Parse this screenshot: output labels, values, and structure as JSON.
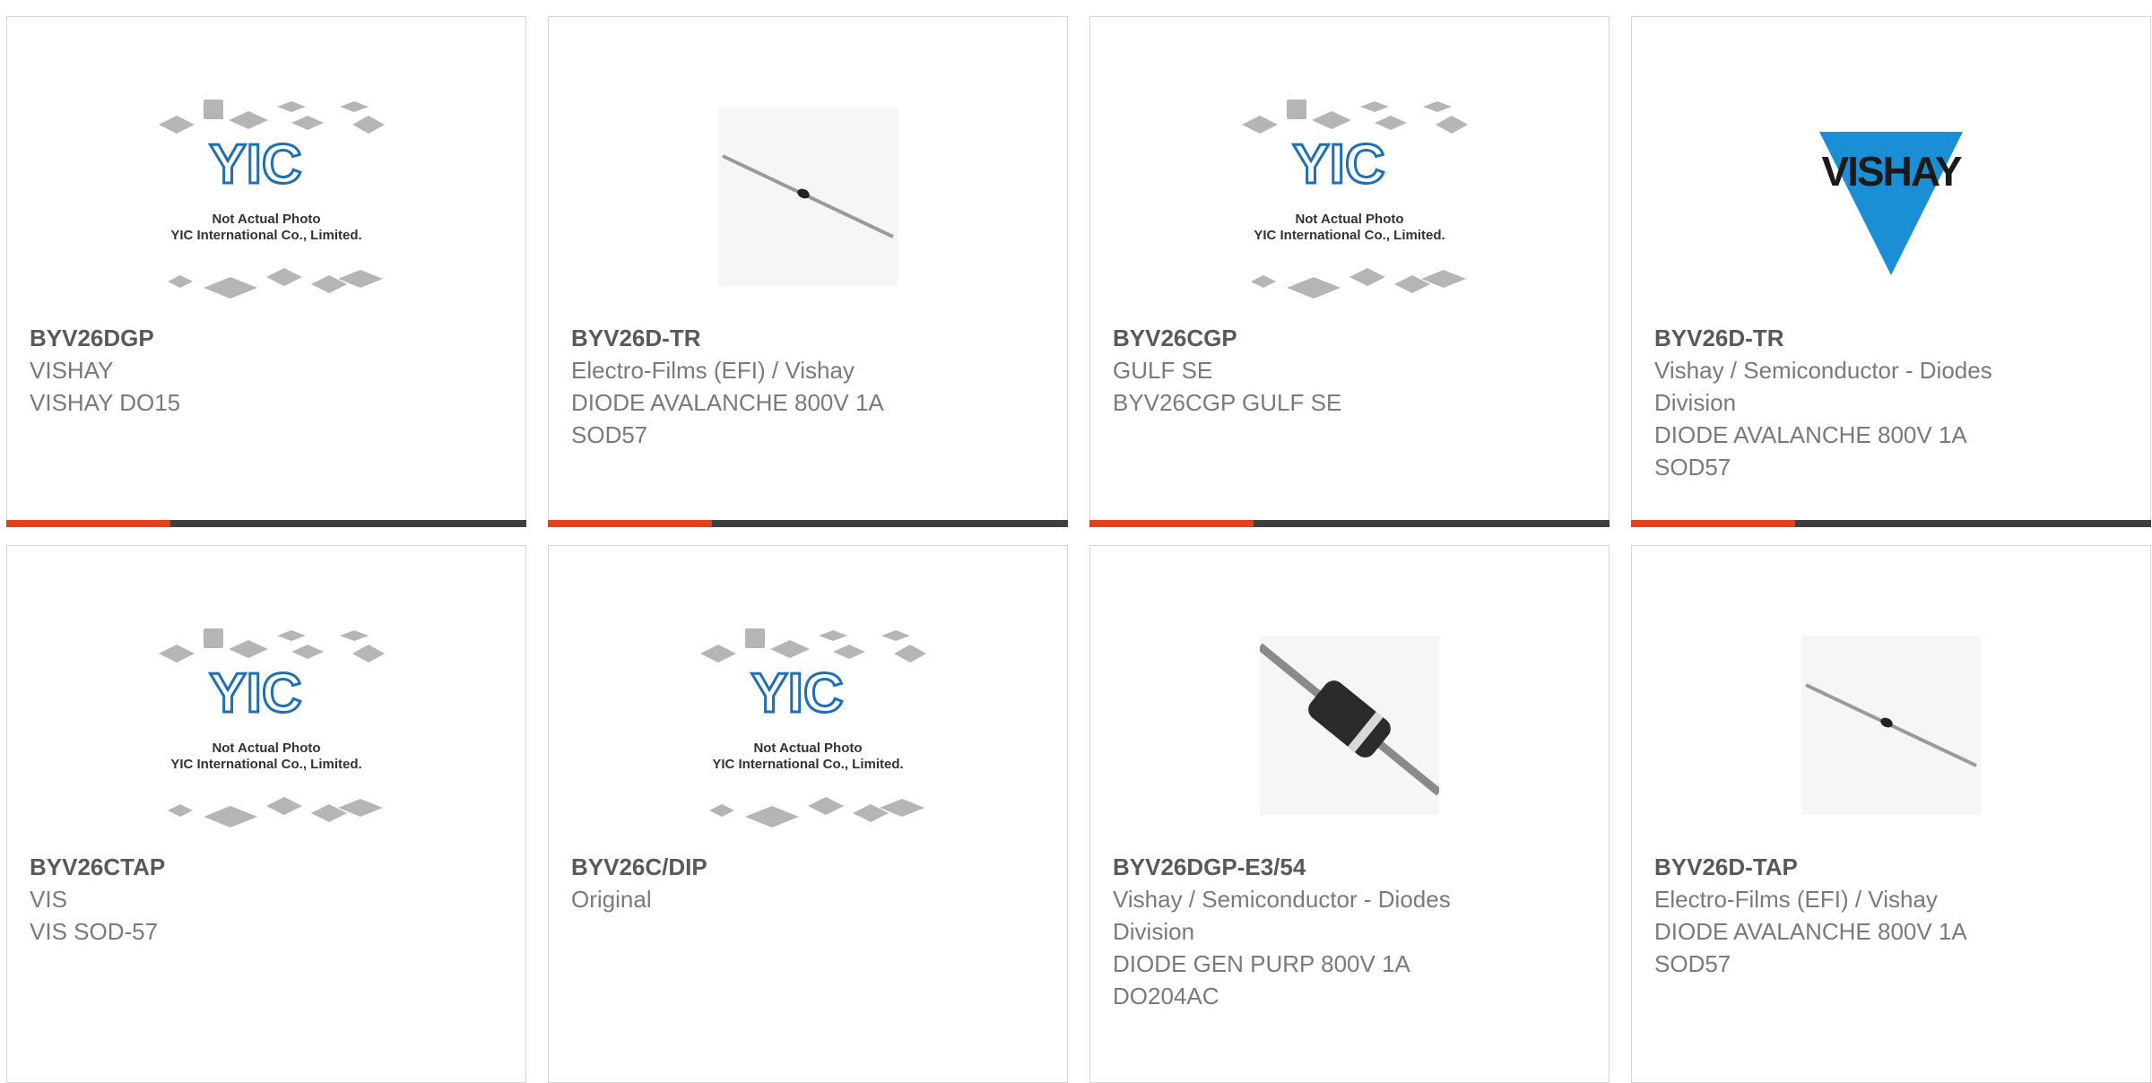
{
  "products": [
    {
      "part": "BYV26DGP",
      "lines": [
        "VISHAY",
        "VISHAY DO15"
      ],
      "image": "yic-placeholder",
      "image_text": [
        "Not Actual Photo",
        "YIC International Co., Limited."
      ]
    },
    {
      "part": "BYV26D-TR",
      "lines": [
        "Electro-Films (EFI) / Vishay",
        "DIODE AVALANCHE 800V 1A",
        "SOD57"
      ],
      "image": "axial-diode-thin"
    },
    {
      "part": "BYV26CGP",
      "lines": [
        "GULF SE",
        "BYV26CGP GULF SE"
      ],
      "image": "yic-placeholder",
      "image_text": [
        "Not Actual Photo",
        "YIC International Co., Limited."
      ]
    },
    {
      "part": "BYV26D-TR",
      "lines": [
        "Vishay / Semiconductor - Diodes",
        "Division",
        "DIODE AVALANCHE 800V 1A",
        "SOD57"
      ],
      "image": "vishay-logo",
      "logo_text": "VISHAY"
    },
    {
      "part": "BYV26CTAP",
      "lines": [
        "VIS",
        "VIS SOD-57"
      ],
      "image": "yic-placeholder",
      "image_text": [
        "Not Actual Photo",
        "YIC International Co., Limited."
      ]
    },
    {
      "part": "BYV26C/DIP",
      "lines": [
        "Original"
      ],
      "image": "yic-placeholder",
      "image_text": [
        "Not Actual Photo",
        "YIC International Co., Limited."
      ]
    },
    {
      "part": "BYV26DGP-E3/54",
      "lines": [
        "Vishay / Semiconductor - Diodes",
        "Division",
        "DIODE GEN PURP 800V 1A",
        "DO204AC"
      ],
      "image": "axial-diode-body"
    },
    {
      "part": "BYV26D-TAP",
      "lines": [
        "Electro-Films (EFI) / Vishay",
        "DIODE AVALANCHE 800V 1A",
        "SOD57"
      ],
      "image": "axial-diode-thin"
    }
  ],
  "colors": {
    "accent": "#e6401a",
    "bar": "#3f3f3f",
    "yic_blue": "#1f6fb5",
    "vishay_blue": "#1b8fd6"
  }
}
